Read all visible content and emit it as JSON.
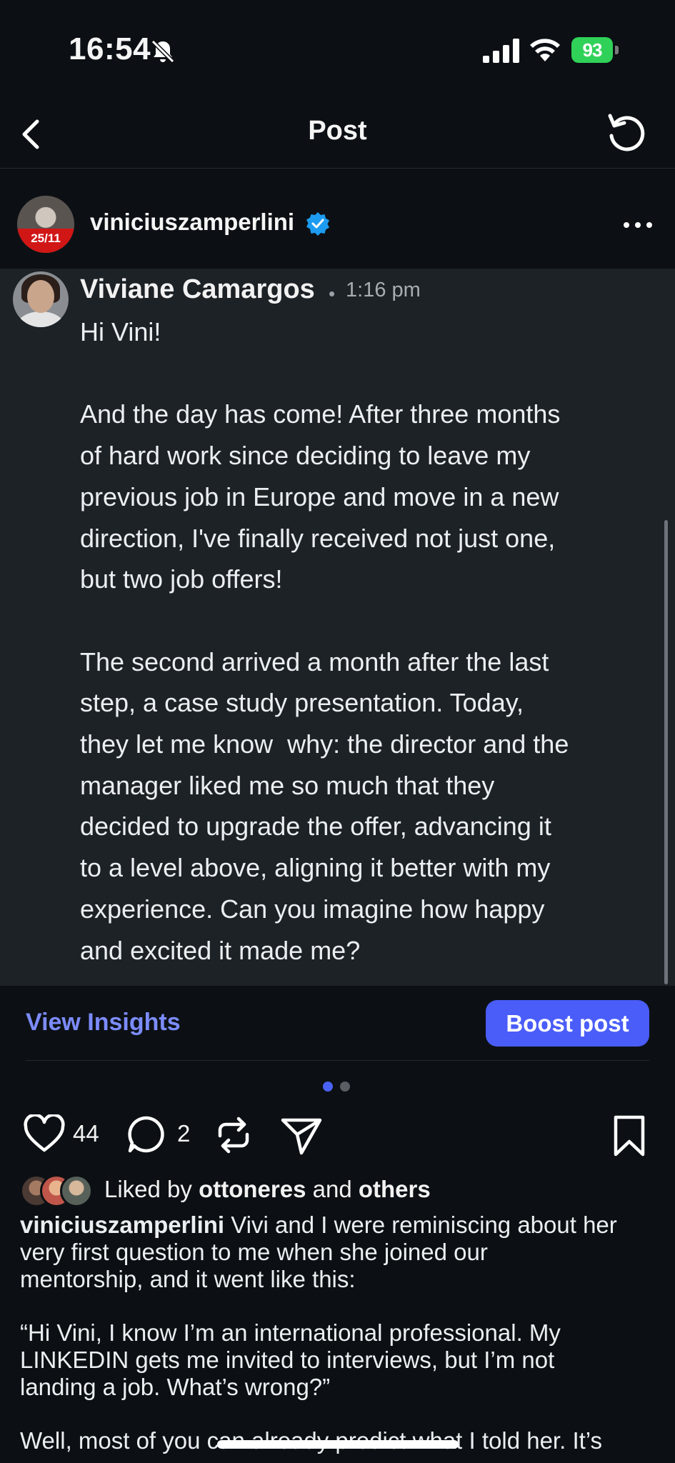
{
  "status_bar": {
    "time": "16:54",
    "battery": "93",
    "battery_color": "#30d158"
  },
  "nav": {
    "title": "Post",
    "back_icon": "chevron-left-icon",
    "refresh_icon": "refresh-icon"
  },
  "author": {
    "username": "viniciuszamperlini",
    "avatar_badge": "25/11",
    "verified_color": "#1d9bf0"
  },
  "embedded_post": {
    "name": "Viviane Camargos",
    "separator": "•",
    "time": "1:16 pm",
    "body": "Hi Vini!\n\nAnd the day has come! After three months\nof hard work since deciding to leave my\nprevious job in Europe and move in a new\ndirection, I've finally received not just one,\nbut two job offers!\n\nThe second arrived a month after the last\nstep, a case study presentation. Today,\nthey let me know  why: the director and the\nmanager liked me so much that they\ndecided to upgrade the offer, advancing it\nto a level above, aligning it better with my\nexperience. Can you imagine how happy\nand excited it made me?"
  },
  "insights": {
    "view_label": "View Insights",
    "boost_label": "Boost post",
    "accent": "#4a5df9",
    "link_color": "#7c8cff"
  },
  "carousel": {
    "current": 1,
    "total": 2
  },
  "actions": {
    "likes": "44",
    "comments": "2"
  },
  "liked_by": {
    "prefix": "Liked by",
    "user": "ottoneres",
    "connector": "and",
    "others": "others"
  },
  "caption": {
    "username": "viniciuszamperlini",
    "text": " Vivi and I were reminiscing about her\nvery first question to me when she joined our\nmentorship, and it went like this:\n\n“Hi Vini, I know I’m an international professional. My\nLINKEDIN gets me invited to interviews, but I’m not\nlanding a job. What’s wrong?”\n\nWell, most of you can already predict what I told her. It’s"
  }
}
